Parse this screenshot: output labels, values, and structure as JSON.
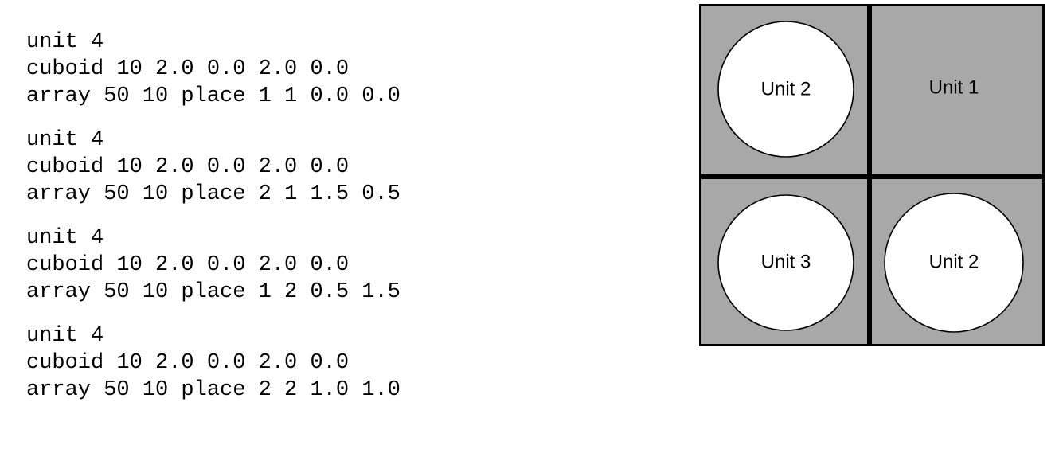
{
  "listing": {
    "blocks": [
      {
        "lines": [
          "unit 4",
          "cuboid 10 2.0 0.0 2.0 0.0",
          "array 50 10 place 1 1 0.0 0.0"
        ]
      },
      {
        "lines": [
          "unit 4",
          "cuboid 10 2.0 0.0 2.0 0.0",
          "array 50 10 place 2 1 1.5 0.5"
        ]
      },
      {
        "lines": [
          "unit 4",
          "cuboid 10 2.0 0.0 2.0 0.0",
          "array 50 10 place 1 2 0.5 1.5"
        ]
      },
      {
        "lines": [
          "unit 4",
          "cuboid 10 2.0 0.0 2.0 0.0",
          "array 50 10 place 2 2 1.0 1.0"
        ]
      }
    ]
  },
  "diagram": {
    "colors": {
      "cell_fill": "#a8a8a8",
      "circle_fill": "#ffffff",
      "stroke": "#000000"
    },
    "cells": [
      {
        "position": "top-left",
        "label": "Unit 2",
        "has_circle": true
      },
      {
        "position": "top-right",
        "label": "Unit 1",
        "has_circle": false
      },
      {
        "position": "bottom-left",
        "label": "Unit 3",
        "has_circle": true
      },
      {
        "position": "bottom-right",
        "label": "Unit 2",
        "has_circle": true
      }
    ]
  }
}
